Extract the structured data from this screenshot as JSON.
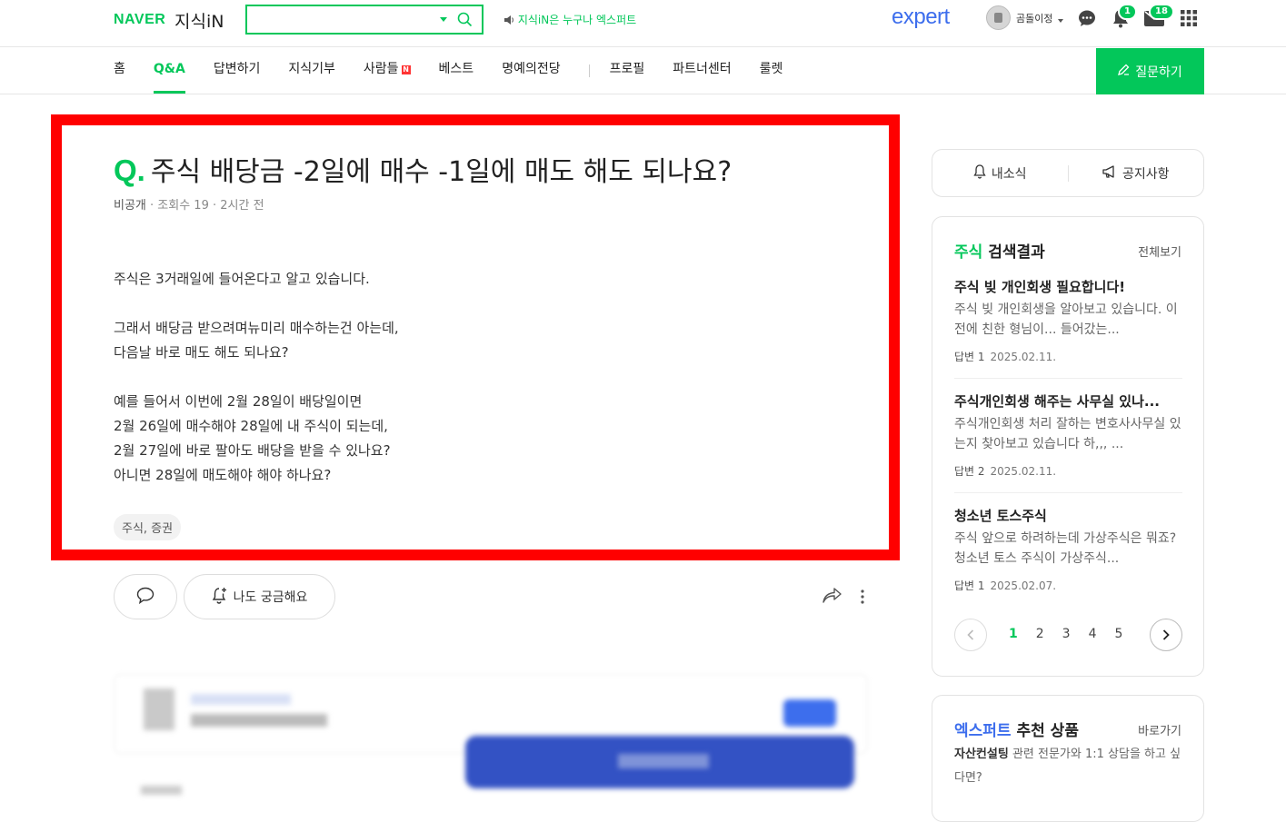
{
  "header": {
    "logo_naver": "NAVER",
    "logo_kin": "지식iN",
    "search_placeholder": "",
    "notice": "지식iN은 누구나 엑스퍼트",
    "expert_logo": "expert",
    "user_name": "곰돌이정",
    "alarm_count": "1",
    "mail_count": "18"
  },
  "menu": {
    "items": [
      "홈",
      "Q&A",
      "답변하기",
      "지식기부",
      "사람들",
      "베스트",
      "명예의전당",
      "프로필",
      "파트너센터",
      "룰렛"
    ],
    "active_index": 1,
    "new_badge": "N",
    "ask_button": "질문하기"
  },
  "question": {
    "q_mark": "Q.",
    "title": "주식 배당금 -2일에 매수 -1일에 매도 해도 되나요?",
    "author": "비공개",
    "views": "조회수 19",
    "time": "2시간 전",
    "paragraphs": [
      [
        "주식은 3거래일에 들어온다고 알고 있습니다."
      ],
      [
        "그래서 배당금 받으려며뉴미리 매수하는건 아는데,",
        "다음날 바로 매도 해도 되나요?"
      ],
      [
        "예를 들어서 이번에 2월 28일이 배당일이면",
        "2월 26일에 매수해야 28일에 내 주식이 되는데,",
        "2월 27일에 바로 팔아도 배당을 받을 수 있나요?",
        "아니면 28일에 매도해야 해야 하나요?"
      ]
    ],
    "tag": "주식, 증권",
    "curious_label": "나도 궁금해요"
  },
  "sidebar": {
    "my_news": "내소식",
    "notice": "공지사항",
    "search_keyword": "주식",
    "search_title_suffix": " 검색결과",
    "view_all": "전체보기",
    "results": [
      {
        "title": "주식 빚 개인회생 필요합니다!",
        "desc": "주식 빚 개인회생을 알아보고 있습니다. 이전에 친한 형님이... 들어갔는...",
        "answers": "답변 1",
        "date": "2025.02.11."
      },
      {
        "title": "주식개인회생 해주는 사무실 있나...",
        "desc": "주식개인회생 처리 잘하는 변호사사무실 있는지 찾아보고 있습니다 하,,, ...",
        "answers": "답변 2",
        "date": "2025.02.11."
      },
      {
        "title": "청소년 토스주식",
        "desc": "주식 앞으로 하려하는데 가상주식은 뭐죠? 청소년 토스 주식이 가상주식...",
        "answers": "답변 1",
        "date": "2025.02.07."
      }
    ],
    "pages": [
      "1",
      "2",
      "3",
      "4",
      "5"
    ],
    "current_page": "1",
    "expert_keyword": "엑스퍼트",
    "expert_title_suffix": " 추천 상품",
    "expert_go": "바로가기",
    "expert_desc_bold": "자산컨설팅",
    "expert_desc_rest": " 관련 전문가와 1:1 상담을 하고 싶다면?"
  },
  "colors": {
    "brand_green": "#03c75a",
    "expert_blue": "#3d6eed",
    "highlight_red": "#ff0000"
  }
}
